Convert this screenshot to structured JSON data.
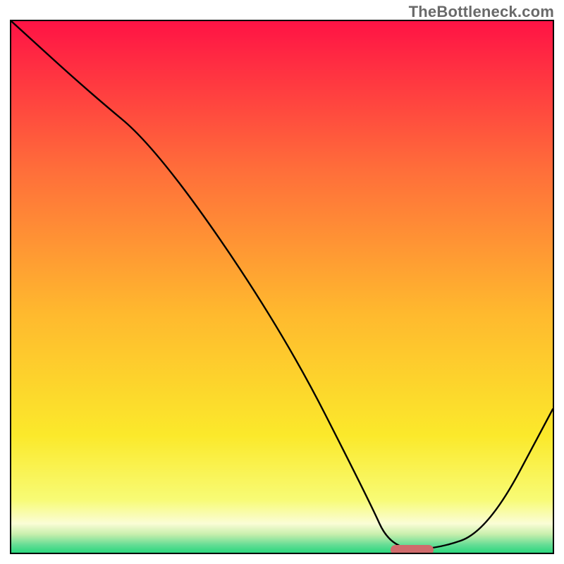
{
  "watermark": "TheBottleneck.com",
  "chart_data": {
    "type": "line",
    "title": "",
    "xlabel": "",
    "ylabel": "",
    "xlim": [
      0,
      100
    ],
    "ylim": [
      0,
      100
    ],
    "grid": false,
    "legend": false,
    "series": [
      {
        "name": "curve",
        "x": [
          0,
          14,
          27,
          50,
          66,
          70,
          78,
          88,
          100
        ],
        "y": [
          100,
          87,
          76,
          42,
          10,
          1,
          0.5,
          4,
          27
        ]
      }
    ],
    "marker": {
      "x_start": 70,
      "x_end": 78,
      "y": 0.5
    },
    "background_gradient_stops": [
      {
        "pos": 0,
        "color": "#ff1345"
      },
      {
        "pos": 0.28,
        "color": "#ff6e3a"
      },
      {
        "pos": 0.55,
        "color": "#ffb92e"
      },
      {
        "pos": 0.78,
        "color": "#fbe92b"
      },
      {
        "pos": 0.9,
        "color": "#f8fb75"
      },
      {
        "pos": 0.945,
        "color": "#fafdd6"
      },
      {
        "pos": 0.965,
        "color": "#c9efad"
      },
      {
        "pos": 0.985,
        "color": "#66dd95"
      },
      {
        "pos": 1.0,
        "color": "#2bd77e"
      }
    ]
  }
}
